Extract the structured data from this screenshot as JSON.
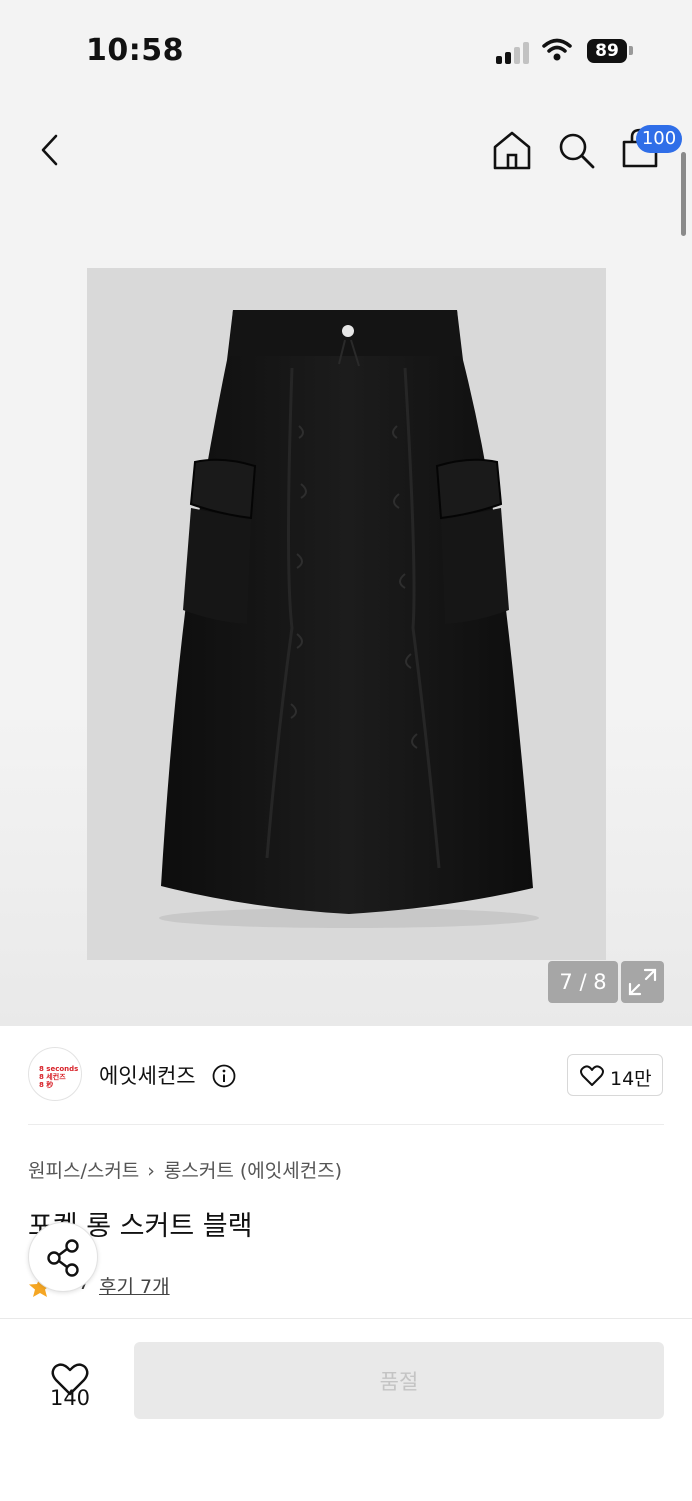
{
  "status_bar": {
    "time": "10:58",
    "battery": "89"
  },
  "header": {
    "cart_count": "100"
  },
  "gallery": {
    "counter": "7 / 8"
  },
  "brand": {
    "logo_lines": [
      "8 seconds",
      "8 세컨즈",
      "8 秒"
    ],
    "name": "에잇세컨즈",
    "follow_count": "14만"
  },
  "breadcrumb": {
    "category": "원피스/스커트",
    "subcategory": "롱스커트 (에잇세컨즈)"
  },
  "product": {
    "title": "포켓 롱 스커트 블랙",
    "rating": "..7",
    "review_link": "후기 7개"
  },
  "bottom_bar": {
    "like_count": "140",
    "buy_label": "품절"
  },
  "colors": {
    "accent": "#2f6ee8",
    "star": "#f5a623",
    "brand_red": "#d8232a"
  }
}
